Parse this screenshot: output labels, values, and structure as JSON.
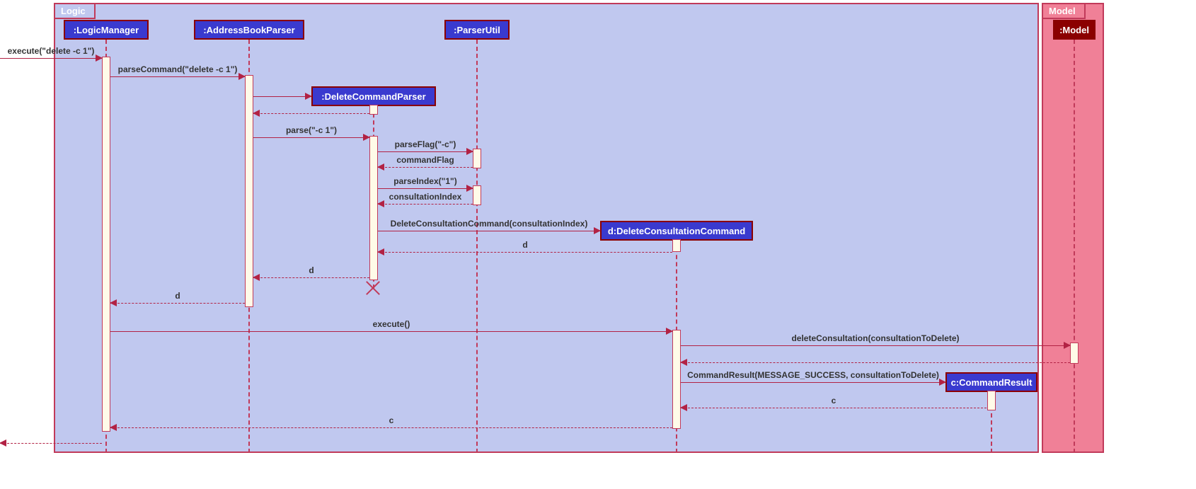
{
  "frames": {
    "logic": "Logic",
    "model": "Model"
  },
  "participants": {
    "logicManager": ":LogicManager",
    "addressBookParser": ":AddressBookParser",
    "parserUtil": ":ParserUtil",
    "deleteCommandParser": ":DeleteCommandParser",
    "deleteConsultationCommand": "d:DeleteConsultationCommand",
    "commandResult": "c:CommandResult",
    "model": ":Model"
  },
  "messages": {
    "m1": "execute(\"delete -c 1\")",
    "m2": "parseCommand(\"delete -c 1\")",
    "m3r": "",
    "m4": "parse(\"-c 1\")",
    "m5": "parseFlag(\"-c\")",
    "m6": "commandFlag",
    "m7": "parseIndex(\"1\")",
    "m8": "consultationIndex",
    "m9": "DeleteConsultationCommand(consultationIndex)",
    "m10": "d",
    "m11": "d",
    "m12": "d",
    "m13": "execute()",
    "m14": "deleteConsultation(consultationToDelete)",
    "m15": "CommandResult(MESSAGE_SUCCESS, consultationToDelete)",
    "m16": "c",
    "m17": "c"
  }
}
